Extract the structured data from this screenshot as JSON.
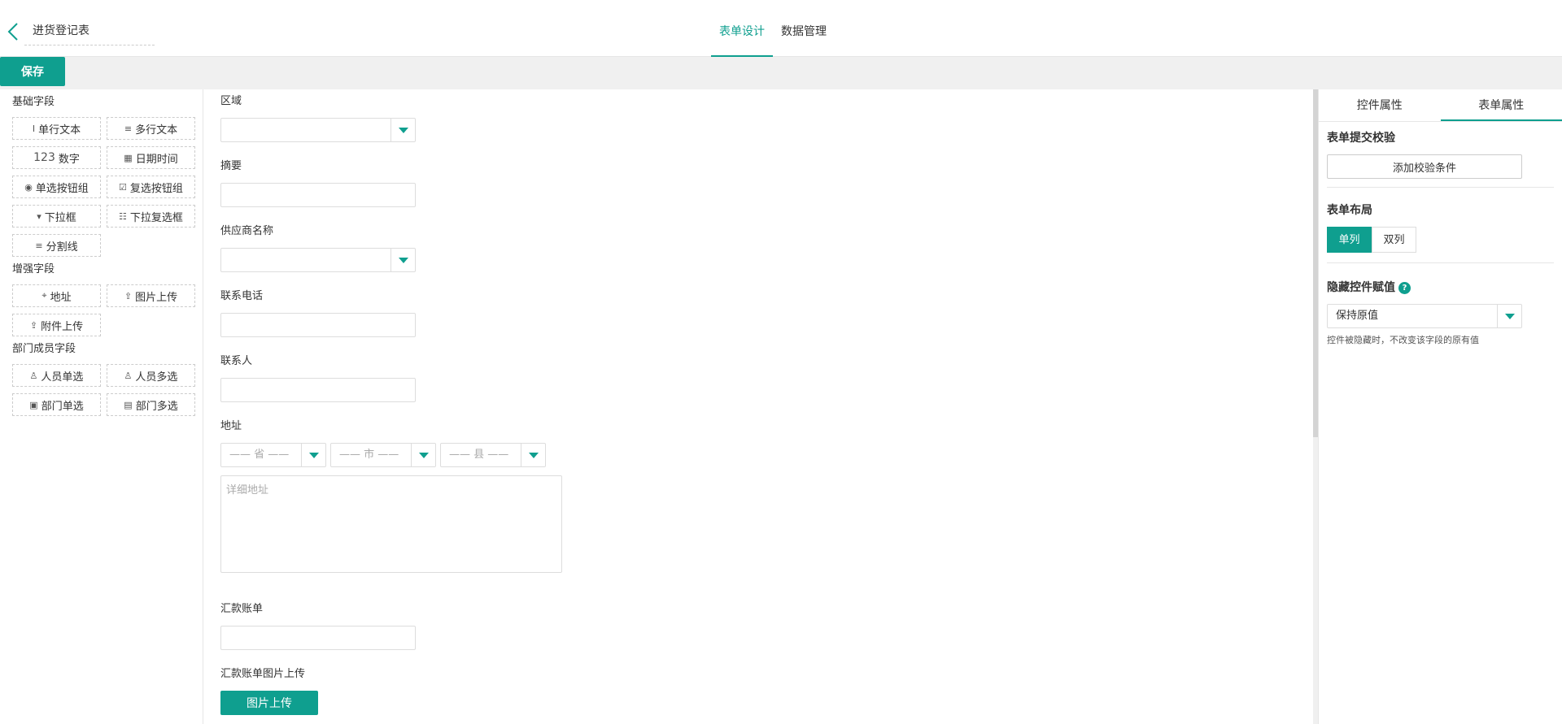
{
  "header": {
    "form_title": "进货登记表",
    "tabs": [
      {
        "label": "表单设计",
        "active": true
      },
      {
        "label": "数据管理",
        "active": false
      }
    ]
  },
  "toolbar": {
    "save_label": "保存"
  },
  "left_panel": {
    "basic_title": "基础字段",
    "basic_fields": [
      {
        "icon": "I",
        "label": "单行文本"
      },
      {
        "icon": "≡",
        "label": "多行文本"
      },
      {
        "icon": "123",
        "label": "数字"
      },
      {
        "icon": "▦",
        "label": "日期时间"
      },
      {
        "icon": "◉",
        "label": "单选按钮组"
      },
      {
        "icon": "☑",
        "label": "复选按钮组"
      },
      {
        "icon": "▾",
        "label": "下拉框"
      },
      {
        "icon": "☷",
        "label": "下拉复选框"
      },
      {
        "icon": "≡",
        "label": "分割线"
      }
    ],
    "enhanced_title": "增强字段",
    "enhanced_fields": [
      {
        "icon": "⌖",
        "label": "地址"
      },
      {
        "icon": "⇪",
        "label": "图片上传"
      },
      {
        "icon": "⇪",
        "label": "附件上传"
      }
    ],
    "dept_title": "部门成员字段",
    "dept_fields": [
      {
        "icon": "♙",
        "label": "人员单选"
      },
      {
        "icon": "♙",
        "label": "人员多选"
      },
      {
        "icon": "▣",
        "label": "部门单选"
      },
      {
        "icon": "▤",
        "label": "部门多选"
      }
    ]
  },
  "canvas": {
    "region_label": "区域",
    "summary_label": "摘要",
    "supplier_label": "供应商名称",
    "phone_label": "联系电话",
    "contact_label": "联系人",
    "address_label": "地址",
    "address_province": "—— 省 ——",
    "address_city": "—— 市 ——",
    "address_county": "—— 县 ——",
    "address_detail_placeholder": "详细地址",
    "remittance_label": "汇款账单",
    "remittance_img_label": "汇款账单图片上传",
    "upload_button": "图片上传"
  },
  "right_panel": {
    "tabs": [
      {
        "label": "控件属性",
        "active": false
      },
      {
        "label": "表单属性",
        "active": true
      }
    ],
    "submit_validation_title": "表单提交校验",
    "add_rule_button": "添加校验条件",
    "layout_title": "表单布局",
    "layout_options": [
      {
        "label": "单列",
        "active": true
      },
      {
        "label": "双列",
        "active": false
      }
    ],
    "hidden_title": "隐藏控件赋值",
    "help_icon": "?",
    "hidden_value": "保持原值",
    "hidden_hint": "控件被隐藏时，不改变该字段的原有值"
  },
  "colors": {
    "accent": "#0f9f8f"
  }
}
